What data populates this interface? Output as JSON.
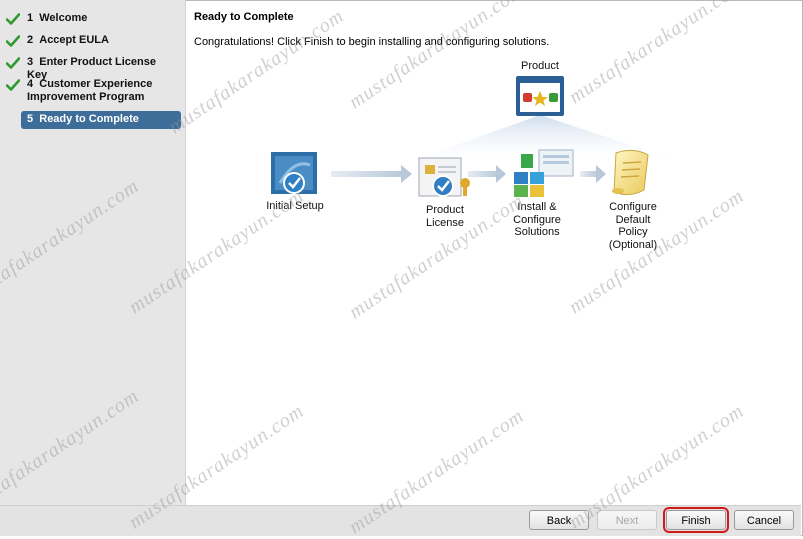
{
  "sidebar": {
    "steps": [
      {
        "number": "1",
        "label": "Welcome",
        "state": "done"
      },
      {
        "number": "2",
        "label": "Accept EULA",
        "state": "done"
      },
      {
        "number": "3",
        "label": "Enter Product License Key",
        "state": "done"
      },
      {
        "number": "4",
        "label": "Customer Experience Improvement Program",
        "state": "done"
      },
      {
        "number": "5",
        "label": "Ready to Complete",
        "state": "current"
      }
    ]
  },
  "main": {
    "title": "Ready to Complete",
    "description": "Congratulations! Click Finish to begin installing and configuring solutions."
  },
  "diagram": {
    "product": "Product",
    "initial_setup": "Initial Setup",
    "product_license_line1": "Product",
    "product_license_line2": "License",
    "install_line1": "Install &",
    "install_line2": "Configure",
    "install_line3": "Solutions",
    "policy_line1": "Configure",
    "policy_line2": "Default",
    "policy_line3": "Policy",
    "policy_line4": "(Optional)"
  },
  "footer": {
    "back": "Back",
    "next": "Next",
    "finish": "Finish",
    "cancel": "Cancel"
  },
  "watermark": {
    "text": "mustafakarakayun.com"
  },
  "colors": {
    "check_green": "#2e9a2e",
    "active_step": "#3e6d99",
    "finish_highlight": "#d21a1a"
  }
}
